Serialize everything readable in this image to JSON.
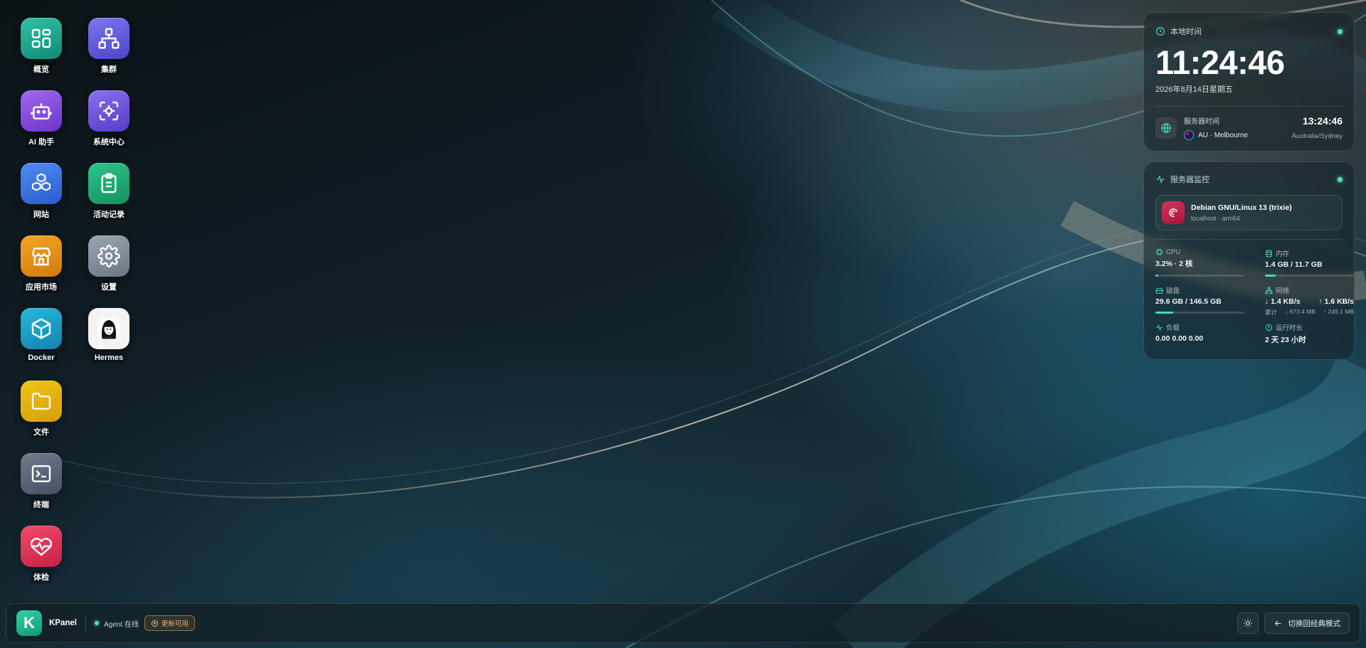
{
  "desktop": {
    "apps": [
      {
        "label": "概览",
        "icon": "dashboard-icon"
      },
      {
        "label": "集群",
        "icon": "cluster-icon"
      },
      {
        "label": "AI 助手",
        "icon": "robot-icon"
      },
      {
        "label": "系统中心",
        "icon": "system-center-icon"
      },
      {
        "label": "网站",
        "icon": "website-cubes-icon"
      },
      {
        "label": "活动记录",
        "icon": "activity-log-icon"
      },
      {
        "label": "应用市场",
        "icon": "app-store-icon"
      },
      {
        "label": "设置",
        "icon": "gear-icon"
      },
      {
        "label": "Docker",
        "icon": "docker-box-icon"
      },
      {
        "label": "Hermes",
        "icon": "hermes-avatar-icon"
      },
      {
        "label": "文件",
        "icon": "folder-icon"
      },
      {
        "label": "终端",
        "icon": "terminal-icon"
      },
      {
        "label": "体检",
        "icon": "health-check-icon"
      }
    ]
  },
  "clock_widget": {
    "title": "本地时间",
    "time": "11:24:46",
    "date": "2026年8月14日星期五",
    "server_time_label": "服务器时间",
    "server_location": "AU · Melbourne",
    "server_time": "13:24:46",
    "server_timezone": "Australia/Sydney"
  },
  "monitor_widget": {
    "title": "服务器监控",
    "os_name": "Debian GNU/Linux 13 (trixie)",
    "host_info": "localhost · arm64",
    "cpu_label": "CPU",
    "cpu_value": "3.2% · 2 核",
    "cpu_usage": 0.032,
    "mem_label": "内存",
    "mem_value": "1.4 GB / 11.7 GB",
    "mem_usage": 0.12,
    "disk_label": "磁盘",
    "disk_value": "29.6 GB / 146.5 GB",
    "disk_usage": 0.2,
    "net_label": "网络",
    "net_down": "↓ 1.4 KB/s",
    "net_up": "↑ 1.6 KB/s",
    "net_total_label": "累计",
    "net_total_down": "↓ 673.4 MB",
    "net_total_up": "↑ 249.1 MB",
    "load_label": "负载",
    "load_value": "0.00 0.00 0.00",
    "uptime_label": "运行时长",
    "uptime_value": "2 天 23 小时"
  },
  "taskbar": {
    "brand_letter": "K",
    "brand_name": "KPanel",
    "agent_status": "Agent 在线",
    "update_badge": "更新可用",
    "mode_button": "切换回经典模式"
  },
  "colors": {
    "accent": "#43d8bd",
    "status_online": "#4fe0c0",
    "update_badge": "#f0b060"
  }
}
